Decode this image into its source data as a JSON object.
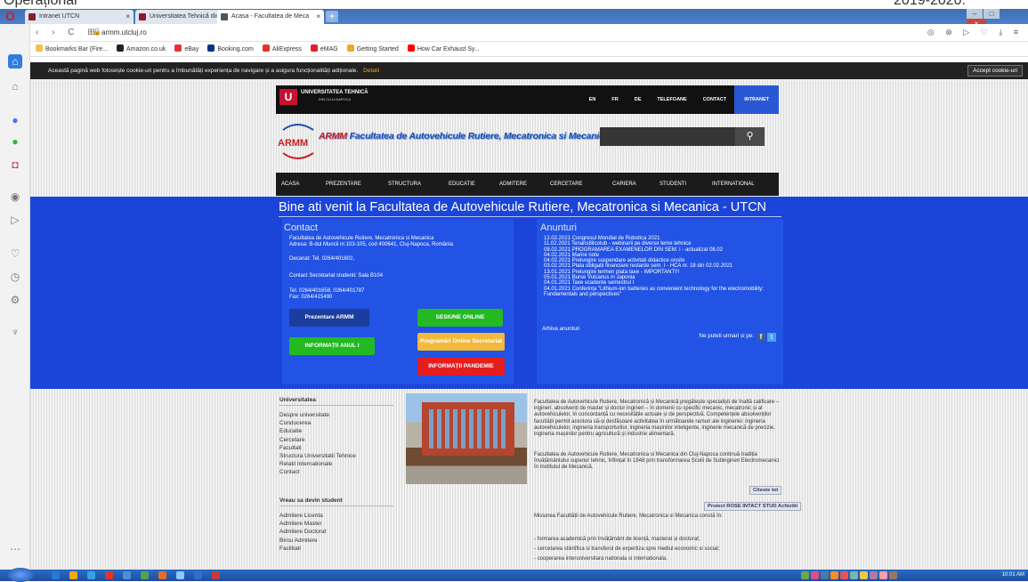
{
  "doc_header": {
    "left": "Operațional",
    "right": "2019-2020:"
  },
  "browser": {
    "tabs": [
      {
        "label": "Intranet UTCN",
        "close": "×"
      },
      {
        "label": "Universitatea Tehnică din C",
        "close": "×"
      },
      {
        "label": "Acasa - Facultatea de Meca",
        "close": "×"
      }
    ],
    "new_tab": "+",
    "nav_icons": "‹ › C ⊞",
    "url": "armm.utcluj.ro",
    "right_icons": "◎ ⊛ ▷ ♡ ⤓ ≡",
    "bookmarks": [
      {
        "label": "Bookmarks Bar (Fire...",
        "color": "#f2c14e"
      },
      {
        "label": "Amazon.co.uk",
        "color": "#222222"
      },
      {
        "label": "eBay",
        "color": "#e53238"
      },
      {
        "label": "Booking.com",
        "color": "#003580"
      },
      {
        "label": "AliExpress",
        "color": "#e43225"
      },
      {
        "label": "eMAG",
        "color": "#e11d2e"
      },
      {
        "label": "Getting Started",
        "color": "#f0a52b"
      },
      {
        "label": "How Car Exhaust Sy...",
        "color": "#ff0000"
      }
    ]
  },
  "cookie": {
    "text": "Această pagină web folosește cookie-uri pentru a îmbunătăți experiența de navigare și a asigura funcționalități adiționale.",
    "details": "Detalii",
    "accept": "Accept cookie-uri"
  },
  "utcn": {
    "name": "UNIVERSITATEA TEHNICĂ",
    "sub": "DIN CLUJ-NAPOCA",
    "menu": [
      "EN",
      "FR",
      "DE",
      "TELEFOANE",
      "CONTACT",
      "INTRANET"
    ]
  },
  "armm": {
    "logo": "ARMM",
    "title_red": "ARMM",
    "title": "Facultatea de Autovehicule Rutiere, Mecatronica si Mecanica"
  },
  "main_menu": [
    "ACASA",
    "PREZENTARE",
    "STRUCTURA",
    "EDUCATIE",
    "ADMITERE",
    "CERCETARE",
    "CARIERA",
    "STUDENTI",
    "INTERNATIONAL"
  ],
  "welcome": "Bine ati venit la Facultatea de Autovehicule Rutiere, Mecatronica si Mecanica - UTCN",
  "contact": {
    "title": "Contact",
    "line1": "Facultatea de Autovehicule Rutiere, Mecatronica si Mecanica",
    "line2": "Adresa: B-dul Muncii nr.103-105, cod 400641, Cluj-Napoca, România",
    "decanat": "Decanat: Tel. 0264/401602,",
    "secretariat": "Contact Secretariat studenti: Sala B104",
    "tel": "Tel. 0264/401658, 0264/401787",
    "fax": "Fax: 0264/415490",
    "buttons": {
      "prezentare": "Prezentare ARMM",
      "sesiune": "SESIUNE ONLINE",
      "anul1": "INFORMAȚII ANUL I",
      "programari": "Programări Online Secretariat",
      "pandemie": "INFORMAȚII PANDEMIE"
    }
  },
  "news": {
    "title": "Anunturi",
    "items": [
      "12.02.2021 Congresul Mondial de Robotica 2021",
      "11.02.2021 Tenaris8ilcotub - webinarii pe diverse teme tehnice",
      "08.02.2021 PROGRAMAREA EXAMENELOR DIN SEM. I - actualizat 08.02",
      "04.02.2021 Marire note",
      "04.02.2021 Prelungire suspendare activitati didactice onsite",
      "03.02.2021 Plata obligatii financiare restante sem. I - HCA nr. 18 din 02.02.2021",
      "13.01.2021 Prelungire termen plata taxe - IMPORTANT!!!",
      "05.01.2021 Burse Vulcanus in Japonia",
      "04.01.2021 Taxe scadente semestrul I",
      "04.01.2021 Conferința \"Lithium-ion batteries as convenient technology for the electromobility: Fundamentals and perspectives\""
    ],
    "archive": "Arhiva anunturi",
    "follow": "Ne puteti urmari si pe:"
  },
  "universitate": {
    "heading": "Universitatea",
    "links": [
      "Despre universitate",
      "Conducerea",
      "Educatie",
      "Cercetare",
      "Facultati",
      "Structura Universitatii Tehnice",
      "Relatii Internationale",
      "Contact"
    ]
  },
  "student": {
    "heading": "Vreau sa devin student",
    "links": [
      "Admitere Licenta",
      "Admitere Master",
      "Admitere Doctorat",
      "Birou Admitere",
      "Facilitati"
    ]
  },
  "about": {
    "p1": "Facultatea de Autovehicule Rutiere, Mecatronică și Mecanică pregătește specialiști de înaltă calificare – ingineri, absolvenți de master și doctor ingineri – în domenii cu specific mecanic, mecatronic și al autovehiculelor, în concordanță cu necesitățile actuale și de perspectivă. Competențele absolvenților facultății permit acestora să-și desfășoare activitatea în următoarele ramuri ale ingineriei: ingineria autovehiculelor, ingineria transporturilor, ingineria mașinilor inteligente, inginerie mecanică de precizie, ingineria mașinilor pentru agricultură și industrie alimentară.",
    "p2": "Facultatea de Autovehicule Rutiere, Mecatronica si Mecanica din Cluj-Napoca continuă tradiția învățământului superior tehnic, înființat în 1948 prin transformarea Școlii de Subingineri Electromecanici în Institutul de Mecanică.",
    "read_more": "Citeste tot",
    "project": "Proiect ROSE INTACT STUD Achizitii",
    "mission": "Misiunea Facultății de Autovehicule Rutiere, Mecatronica si Mecanica constă în:",
    "m1": "- formarea academică prin învățământ de licență, masterat și doctorat;",
    "m2": "- cercetarea stiintifica si transferul de expertiza spre mediul economic si social;",
    "m3": "- cooperarea interuniversitara nationala si internationala."
  },
  "taskbar": {
    "time": "10:01 AM",
    "icons": [
      "#2b78d8",
      "#f2a900",
      "#3aa1e0",
      "#e2332d",
      "#4a90d9",
      "#59a14f",
      "#e76a2a",
      "#8ec6ff",
      "#2f6fd1",
      "#c63b3b",
      "#6aa84f",
      "#d94f8a",
      "#4e79a7",
      "#f28e2b",
      "#e15759",
      "#76b7b2",
      "#edc948",
      "#b07aa1",
      "#ff9da7",
      "#9c755f"
    ]
  },
  "colors": {
    "accent_blue": "#1b44d8",
    "box_blue": "#2253e4",
    "utcn_red": "#c51230"
  }
}
